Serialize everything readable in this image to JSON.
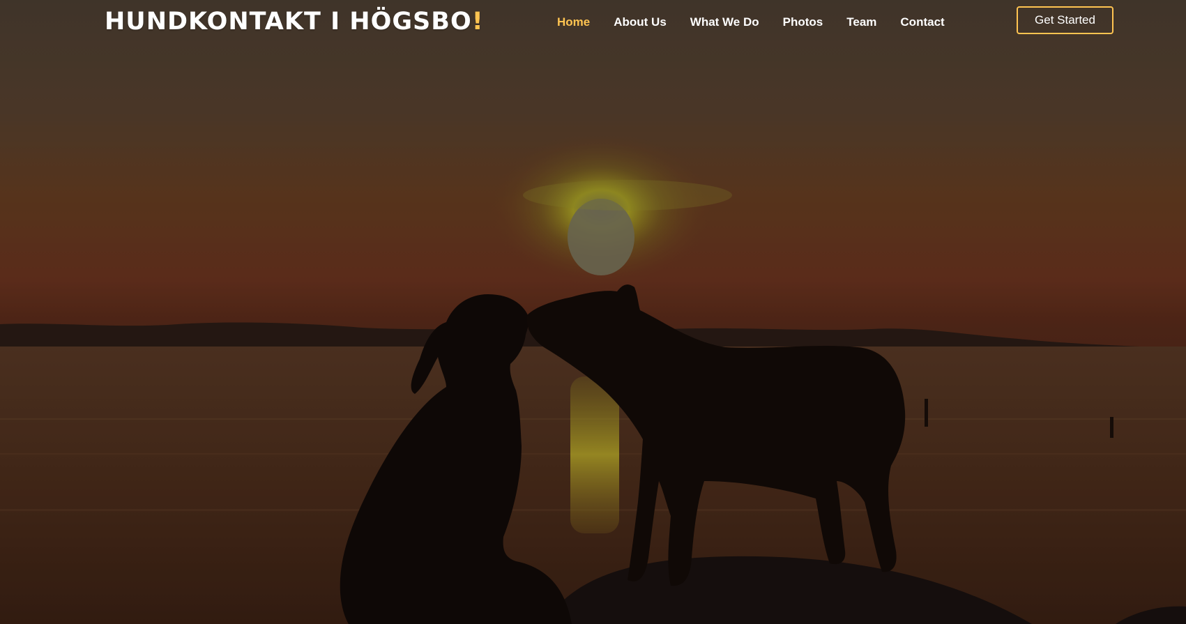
{
  "brand": {
    "name": "HUNDKONTAKT I HÖGSBO",
    "accent_mark": "!",
    "accent_color": "#ffc451"
  },
  "nav": {
    "items": [
      {
        "label": "Home",
        "active": true
      },
      {
        "label": "About Us",
        "active": false
      },
      {
        "label": "What We Do",
        "active": false
      },
      {
        "label": "Photos",
        "active": false
      },
      {
        "label": "Team",
        "active": false
      },
      {
        "label": "Contact",
        "active": false
      }
    ]
  },
  "cta": {
    "label": "Get Started"
  },
  "hero": {
    "image": "sunset-silhouette-woman-kissing-dog"
  }
}
